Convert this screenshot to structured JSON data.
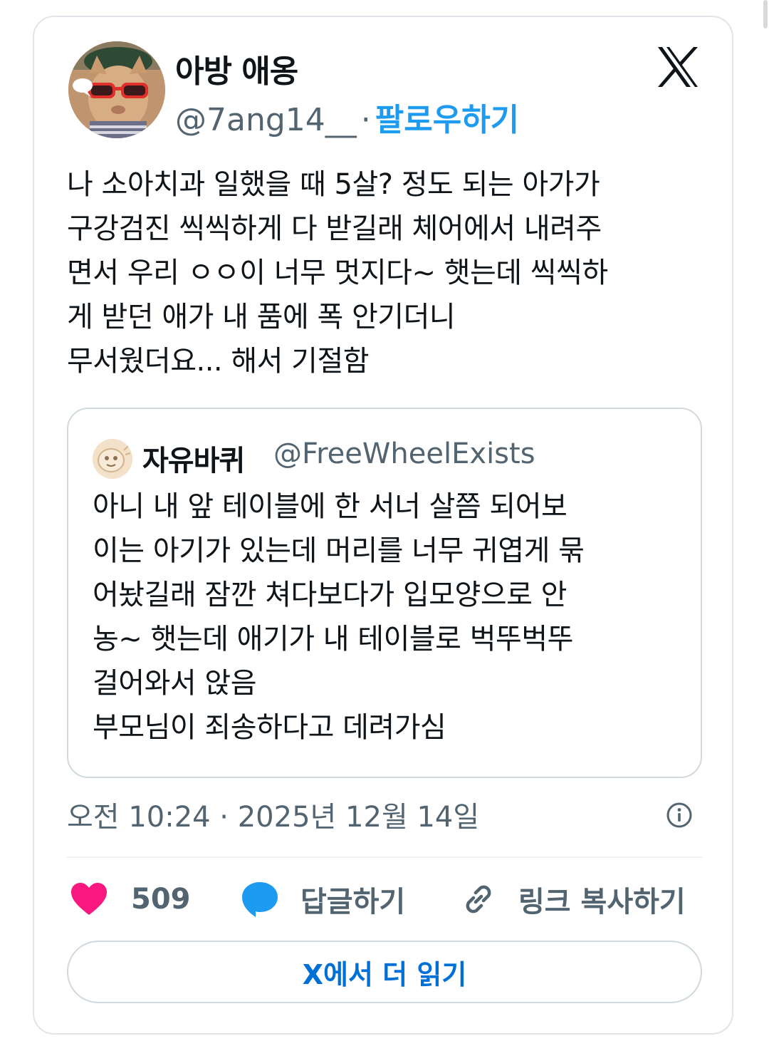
{
  "tweet": {
    "author": {
      "name": "아방 애옹",
      "handle": "@7ang14__",
      "separator": "·",
      "follow_label": "팔로우하기",
      "avatar": "cat-with-red-sunglasses"
    },
    "text": "나 소아치과 일했을 때 5살? 정도 되는 아가가\n구강검진 씩씩하게 다 받길래 체어에서 내려주\n면서 우리 ㅇㅇ이 너무 멋지다~ 햇는데 씩씩하\n게 받던 애가 내 품에 폭 안기더니\n무서웠더요... 해서 기절함",
    "quote": {
      "name": "자유바퀴",
      "handle": "@FreeWheelExists",
      "avatar": "drawn-character-avatar",
      "text": "아니 내 앞 테이블에 한 서너 살쯤 되어보\n이는 아기가 있는데 머리를 너무 귀엽게 묶\n어놨길래 잠깐 쳐다보다가 입모양으로 안\n농~ 햇는데 애기가 내 테이블로 벅뚜벅뚜\n걸어와서 앉음\n부모님이 죄송하다고 데려가심"
    },
    "timestamp": "오전 10:24 · 2025년 12월 14일",
    "actions": {
      "like_count": "509",
      "reply_label": "답글하기",
      "copy_link_label": "링크 복사하기"
    },
    "read_more_label": "X에서 더 읽기"
  },
  "icons": {
    "brand": "x-logo",
    "info": "info-icon",
    "like": "heart-icon",
    "reply": "speech-bubble-icon",
    "copy": "link-icon"
  },
  "colors": {
    "follow": "#1d9bf0",
    "like": "#f91880",
    "reply": "#1d9bf0",
    "read_more": "#006fd6",
    "secondary_text": "#536471"
  }
}
